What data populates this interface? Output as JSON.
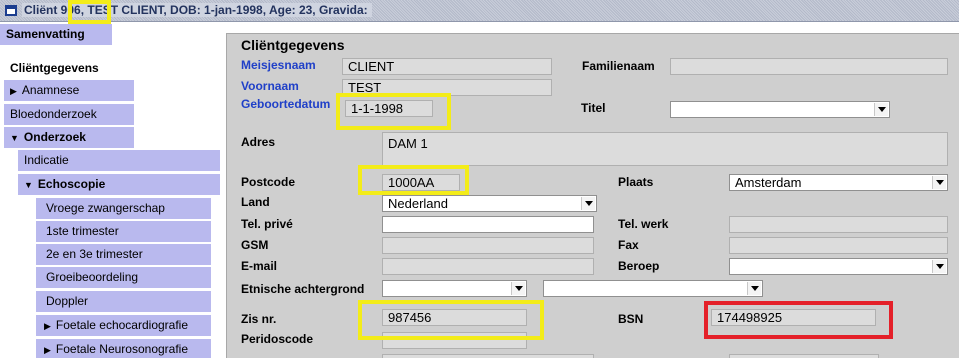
{
  "window": {
    "title": "Cliënt  906, TEST CLIENT, DOB: 1-jan-1998, Age: 23, Gravida:"
  },
  "sidebar": {
    "items": [
      {
        "label": "Samenvatting",
        "icon": ""
      },
      {
        "label": "Cliëntgegevens",
        "icon": ""
      },
      {
        "label": "Anamnese",
        "icon": "triangle-right-icon"
      },
      {
        "label": "Bloedonderzoek",
        "icon": ""
      },
      {
        "label": "Onderzoek",
        "icon": "triangle-down-icon"
      },
      {
        "label": "Indicatie",
        "icon": ""
      },
      {
        "label": "Echoscopie",
        "icon": "triangle-down-icon"
      },
      {
        "label": "Vroege zwangerschap",
        "icon": ""
      },
      {
        "label": "1ste trimester",
        "icon": ""
      },
      {
        "label": "2e en 3e trimester",
        "icon": ""
      },
      {
        "label": "Groeibeoordeling",
        "icon": ""
      },
      {
        "label": "Doppler",
        "icon": ""
      },
      {
        "label": "Foetale echocardiografie",
        "icon": "triangle-right-icon"
      },
      {
        "label": "Foetale Neurosonografie",
        "icon": "triangle-right-icon"
      }
    ]
  },
  "form": {
    "title": "Cliëntgegevens",
    "meisjesnaam": {
      "label": "Meisjesnaam",
      "value": "CLIENT"
    },
    "familienaam": {
      "label": "Familienaam",
      "value": ""
    },
    "voornaam": {
      "label": "Voornaam",
      "value": "TEST"
    },
    "geboortedatum": {
      "label": "Geboortedatum",
      "value": "1-1-1998"
    },
    "titel": {
      "label": "Titel",
      "value": ""
    },
    "adres": {
      "label": "Adres",
      "value": "DAM 1"
    },
    "postcode": {
      "label": "Postcode",
      "value": "1000AA"
    },
    "plaats": {
      "label": "Plaats",
      "value": "Amsterdam"
    },
    "land": {
      "label": "Land",
      "value": "Nederland"
    },
    "tel_prive": {
      "label": "Tel. privé",
      "value": ""
    },
    "tel_werk": {
      "label": "Tel. werk",
      "value": ""
    },
    "gsm": {
      "label": "GSM",
      "value": ""
    },
    "fax": {
      "label": "Fax",
      "value": ""
    },
    "email": {
      "label": "E-mail",
      "value": ""
    },
    "beroep": {
      "label": "Beroep",
      "value": ""
    },
    "etnische": {
      "label": "Etnische achtergrond",
      "value": "",
      "value2": ""
    },
    "zis_nr": {
      "label": "Zis nr.",
      "value": "987456"
    },
    "bsn": {
      "label": "BSN",
      "value": "174498925"
    },
    "peridoscode": {
      "label": "Peridoscode",
      "value": ""
    }
  },
  "colors": {
    "sidebar_item": "#b9b9ee",
    "form_background": "#cfcfcf",
    "field_label_blue": "#2040c8",
    "highlight_yellow": "#f3ec19",
    "highlight_red": "#e42029"
  }
}
